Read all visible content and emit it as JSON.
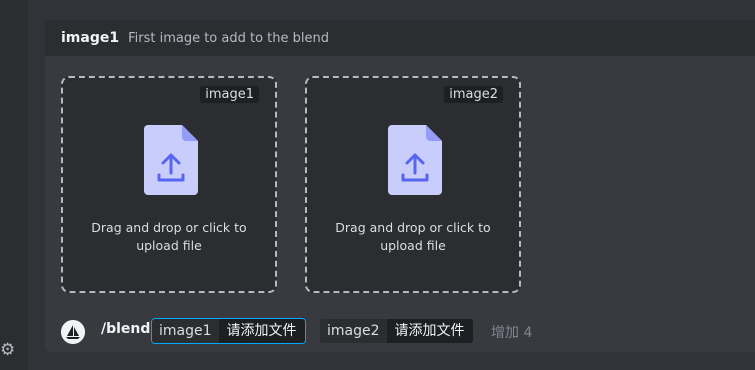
{
  "panel": {
    "option_name": "image1",
    "option_description": "First image to add to the blend"
  },
  "dropzones": [
    {
      "tag": "image1",
      "text": "Drag and drop or click to upload file"
    },
    {
      "tag": "image2",
      "text": "Drag and drop or click to upload file"
    }
  ],
  "command": {
    "name": "/blend",
    "options": [
      {
        "key": "image1",
        "value": "请添加文件"
      },
      {
        "key": "image2",
        "value": "请添加文件"
      }
    ],
    "more": "增加 4"
  },
  "icons": {
    "settings": "gear-icon",
    "upload": "file-upload-icon",
    "bot": "sailboat-bot-icon"
  },
  "colors": {
    "background": "#313338",
    "panel": "#383a40",
    "header": "#2b2d31",
    "accent_border": "#00a8fc",
    "upload_icon": "#5865f2"
  }
}
